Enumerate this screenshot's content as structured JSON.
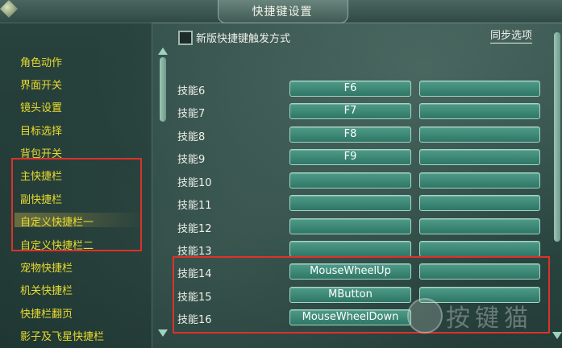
{
  "window": {
    "title": "快捷键设置"
  },
  "left_menu": {
    "items": [
      "角色动作",
      "界面开关",
      "镜头设置",
      "目标选择",
      "背包开关",
      "主快捷栏",
      "副快捷栏",
      "自定义快捷栏一",
      "自定义快捷栏二",
      "宠物快捷栏",
      "机关快捷栏",
      "快捷栏翻页",
      "影子及飞星快捷栏"
    ],
    "selected": "自定义快捷栏一"
  },
  "options": {
    "new_trigger_label": "新版快捷键触发方式",
    "new_trigger_checked": false,
    "sync_label": "同步选项"
  },
  "skills": [
    {
      "label": "技能6",
      "primary": "F6",
      "secondary": ""
    },
    {
      "label": "技能7",
      "primary": "F7",
      "secondary": ""
    },
    {
      "label": "技能8",
      "primary": "F8",
      "secondary": ""
    },
    {
      "label": "技能9",
      "primary": "F9",
      "secondary": ""
    },
    {
      "label": "技能10",
      "primary": "",
      "secondary": ""
    },
    {
      "label": "技能11",
      "primary": "",
      "secondary": ""
    },
    {
      "label": "技能12",
      "primary": "",
      "secondary": ""
    },
    {
      "label": "技能13",
      "primary": "",
      "secondary": ""
    },
    {
      "label": "技能14",
      "primary": "MouseWheelUp",
      "secondary": ""
    },
    {
      "label": "技能15",
      "primary": "MButton",
      "secondary": ""
    },
    {
      "label": "技能16",
      "primary": "MouseWheelDown",
      "secondary": ""
    }
  ],
  "watermark": {
    "text": "按键猫"
  },
  "colors": {
    "menu_text": "#e9dc2e",
    "key_box": "#3f8a78",
    "highlight_border": "#e0302a"
  }
}
